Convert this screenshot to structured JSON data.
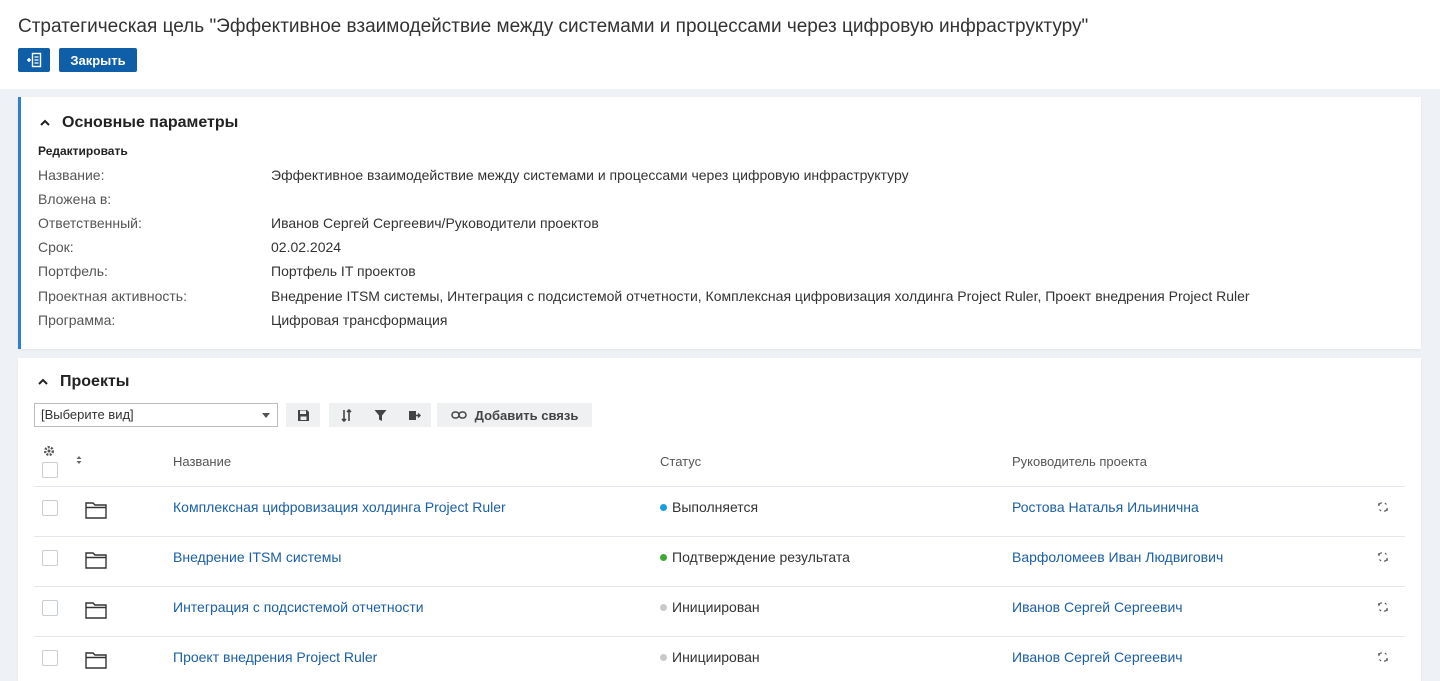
{
  "page": {
    "title": "Стратегическая цель \"Эффективное взаимодействие между системами и процессами через цифровую инфраструктуру\"",
    "close_label": "Закрыть"
  },
  "params": {
    "section_title": "Основные параметры",
    "edit_label": "Редактировать",
    "rows": [
      {
        "label": "Название:",
        "value": "Эффективное взаимодействие между системами и процессами через цифровую инфраструктуру"
      },
      {
        "label": "Вложена в:",
        "value": ""
      },
      {
        "label": "Ответственный:",
        "value": "Иванов Сергей Сергеевич/Руководители проектов"
      },
      {
        "label": "Срок:",
        "value": "02.02.2024"
      },
      {
        "label": "Портфель:",
        "value": "Портфель IT проектов"
      },
      {
        "label": "Проектная активность:",
        "value": "Внедрение ITSM системы, Интеграция с подсистемой отчетности, Комплексная цифровизация холдинга Project Ruler, Проект внедрения Project Ruler"
      },
      {
        "label": "Программа:",
        "value": "Цифровая трансформация"
      }
    ]
  },
  "projects": {
    "section_title": "Проекты",
    "view_select": "[Выберите вид]",
    "add_link_label": "Добавить связь",
    "columns": [
      "Название",
      "Статус",
      "Руководитель проекта"
    ],
    "rows": [
      {
        "name": "Комплексная цифровизация холдинга Project Ruler",
        "status": "Выполняется",
        "status_color": "#1a9be6",
        "manager": "Ростова Наталья Ильинична"
      },
      {
        "name": "Внедрение ITSM системы",
        "status": "Подтверждение результата",
        "status_color": "#3aa935",
        "manager": "Варфоломеев Иван Людвигович"
      },
      {
        "name": "Интеграция с подсистемой отчетности",
        "status": "Инициирован",
        "status_color": "#c9c9c9",
        "manager": "Иванов Сергей Сергеевич"
      },
      {
        "name": "Проект внедрения Project Ruler",
        "status": "Инициирован",
        "status_color": "#c9c9c9",
        "manager": "Иванов Сергей Сергеевич"
      }
    ]
  },
  "colors": {
    "accent": "#0f5fa8",
    "link": "#1b5fa5",
    "section_border": "#2f7fd1"
  }
}
